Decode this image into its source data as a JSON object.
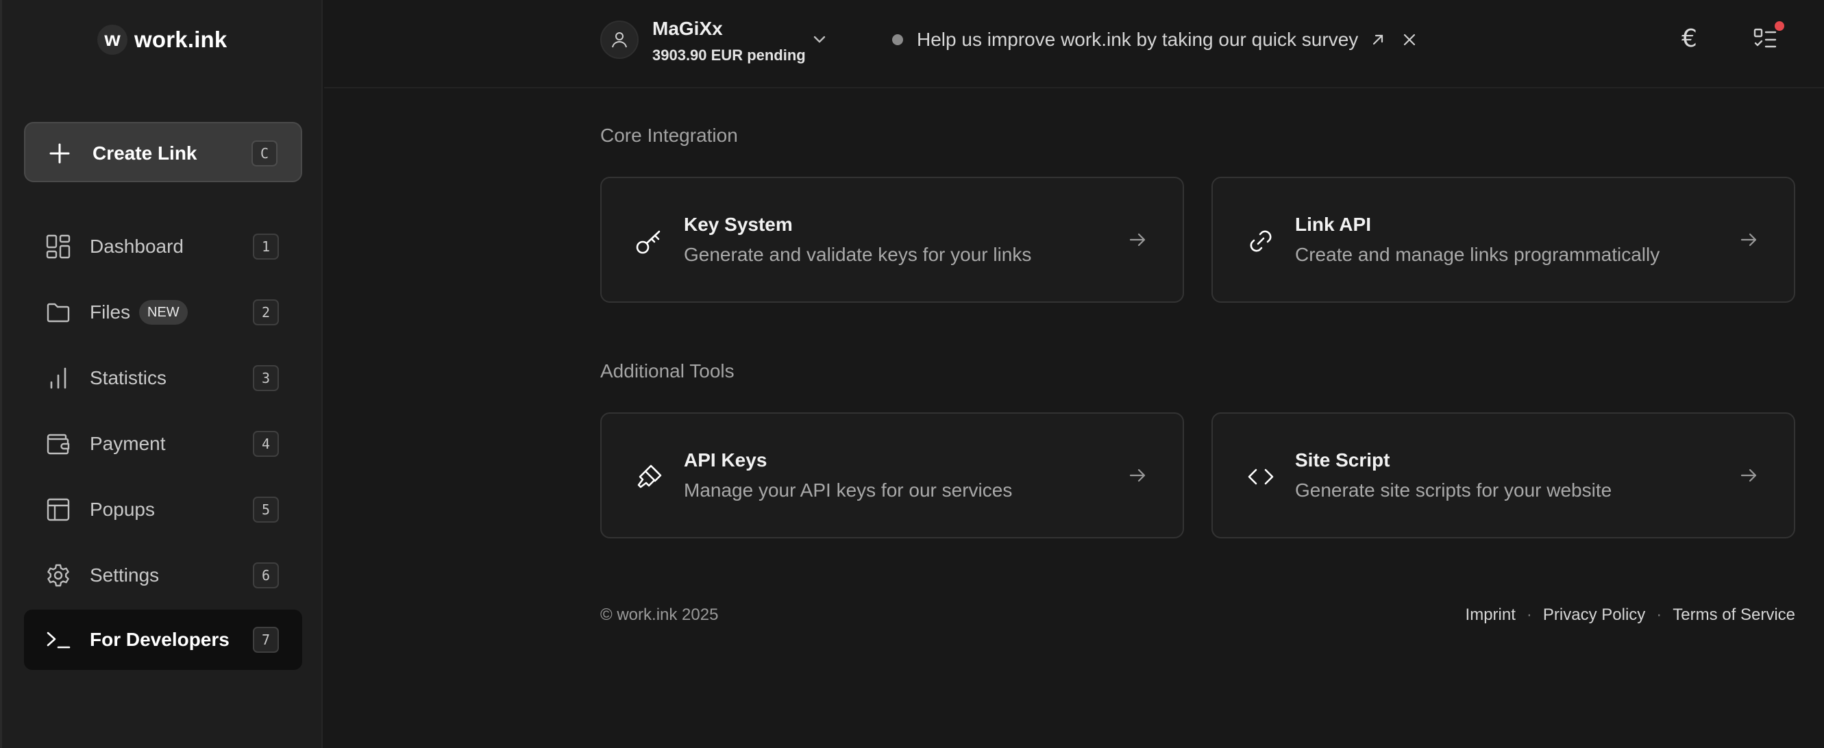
{
  "sidebar": {
    "logo_mark": "w",
    "logo_text": "work.ink",
    "create_link": {
      "label": "Create Link",
      "shortcut": "C",
      "icon": "plus-icon"
    },
    "items": [
      {
        "label": "Dashboard",
        "shortcut": "1",
        "icon": "dashboard-icon"
      },
      {
        "label": "Files",
        "shortcut": "2",
        "icon": "folder-icon",
        "badge": "NEW"
      },
      {
        "label": "Statistics",
        "shortcut": "3",
        "icon": "bar-chart-icon"
      },
      {
        "label": "Payment",
        "shortcut": "4",
        "icon": "wallet-icon"
      },
      {
        "label": "Popups",
        "shortcut": "5",
        "icon": "layout-icon"
      },
      {
        "label": "Settings",
        "shortcut": "6",
        "icon": "gear-icon"
      },
      {
        "label": "For Developers",
        "shortcut": "7",
        "icon": "terminal-icon",
        "active": true
      }
    ]
  },
  "header": {
    "user_name": "MaGiXx",
    "balance": "3903.90 EUR pending",
    "survey_text": "Help us improve work.ink by taking our quick survey",
    "currency_symbol": "€"
  },
  "main": {
    "sections": [
      {
        "title": "Core Integration",
        "cards": [
          {
            "title": "Key System",
            "description": "Generate and validate keys for your links",
            "icon": "key-icon"
          },
          {
            "title": "Link API",
            "description": "Create and manage links programmatically",
            "icon": "link-icon"
          }
        ]
      },
      {
        "title": "Additional Tools",
        "cards": [
          {
            "title": "API Keys",
            "description": "Manage your API keys for our services",
            "icon": "api-keys-icon"
          },
          {
            "title": "Site Script",
            "description": "Generate site scripts for your website",
            "icon": "code-icon"
          }
        ]
      }
    ]
  },
  "footer": {
    "copyright": "© work.ink 2025",
    "links": [
      "Imprint",
      "Privacy Policy",
      "Terms of Service"
    ],
    "separator": "·"
  },
  "colors": {
    "background": "#181818",
    "sidebar": "#1e1e1e",
    "card_border": "#333333",
    "notification_dot": "#e5484d"
  }
}
